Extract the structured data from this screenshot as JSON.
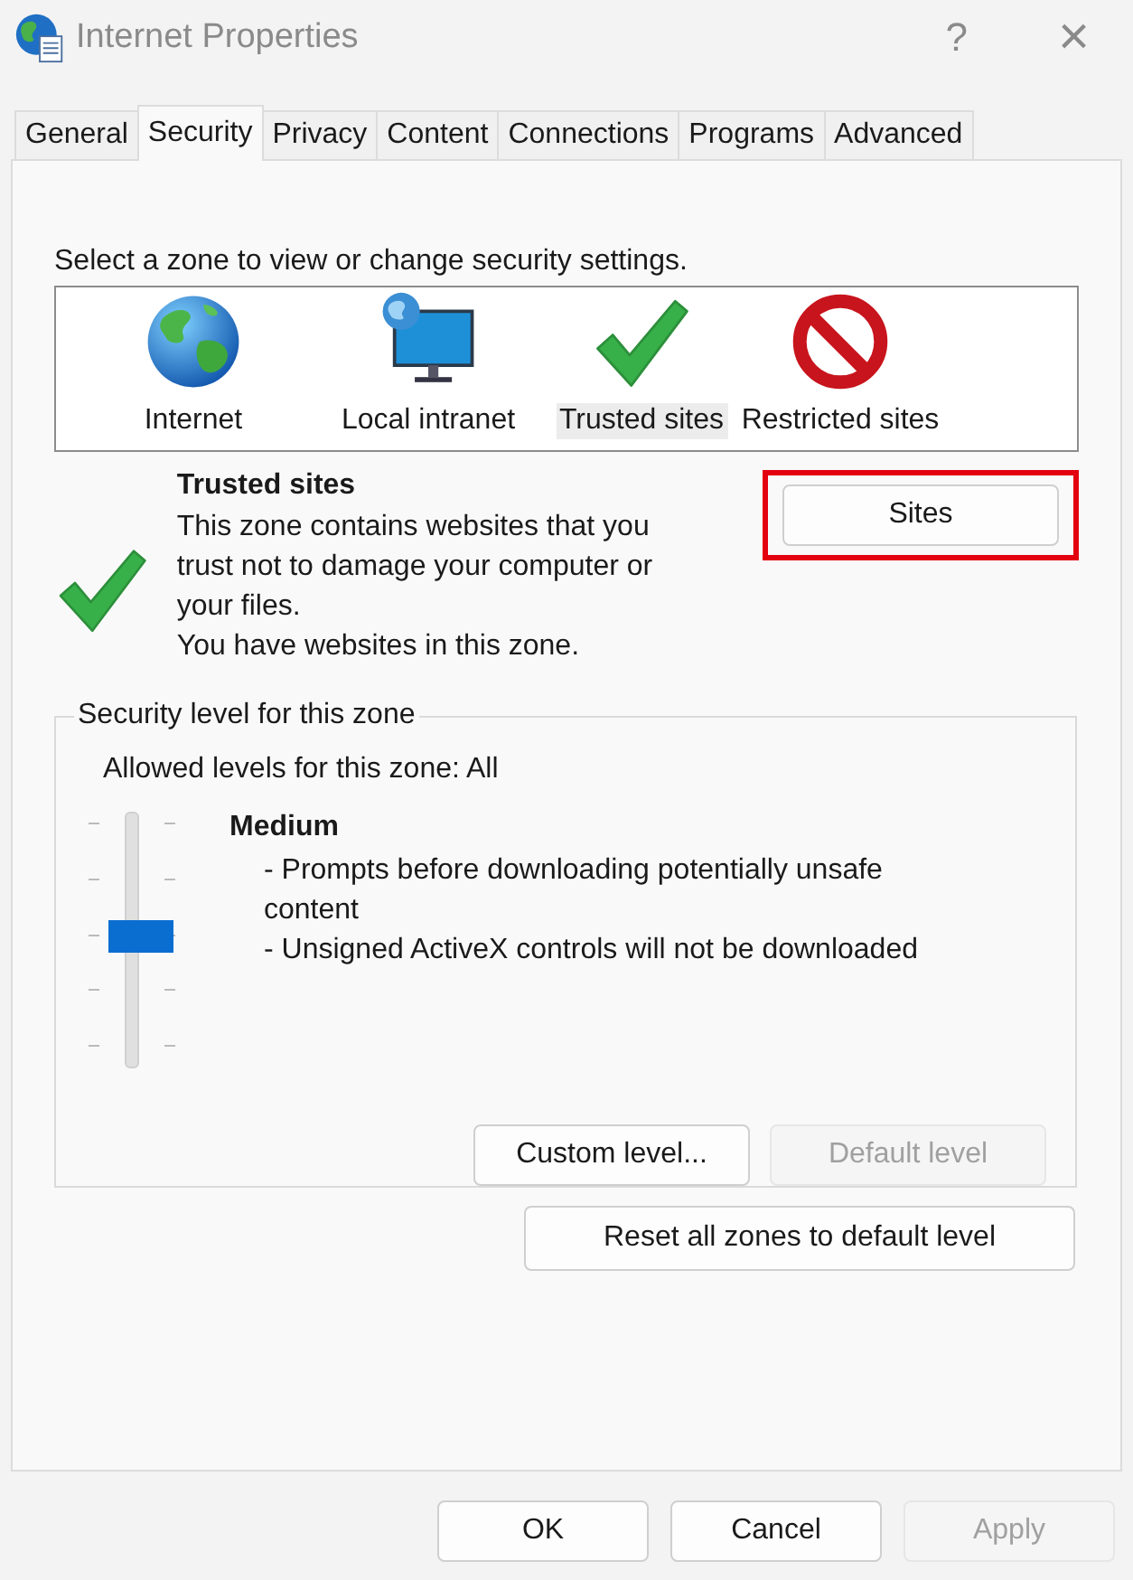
{
  "window": {
    "title": "Internet Properties",
    "help": "?",
    "close": "×"
  },
  "tabs": [
    {
      "label": "General",
      "selected": false
    },
    {
      "label": "Security",
      "selected": true
    },
    {
      "label": "Privacy",
      "selected": false
    },
    {
      "label": "Content",
      "selected": false
    },
    {
      "label": "Connections",
      "selected": false
    },
    {
      "label": "Programs",
      "selected": false
    },
    {
      "label": "Advanced",
      "selected": false
    }
  ],
  "zone_prompt": "Select a zone to view or change security settings.",
  "zones": [
    {
      "label": "Internet",
      "kind": "globe",
      "selected": false
    },
    {
      "label": "Local intranet",
      "kind": "intranet",
      "selected": false
    },
    {
      "label": "Trusted sites",
      "kind": "trusted",
      "selected": true
    },
    {
      "label": "Restricted sites",
      "kind": "restricted",
      "selected": false
    }
  ],
  "zone_info": {
    "kind": "trusted",
    "title": "Trusted sites",
    "description": [
      "This zone contains websites that you trust not to damage your computer or your files.",
      "You have websites in this zone."
    ],
    "button": {
      "label": "Sites",
      "highlighted": true
    }
  },
  "security_level": {
    "legend": "Security level for this zone",
    "allowed": "Allowed levels for this zone: All",
    "level": 0.5,
    "name": "Medium",
    "details": [
      "- Prompts before downloading potentially unsafe content",
      "- Unsigned ActiveX controls will not be downloaded"
    ],
    "buttons": [
      {
        "label": "Custom level...",
        "disabled": false
      },
      {
        "label": "Default level",
        "disabled": true
      }
    ]
  },
  "reset_button": {
    "label": "Reset all zones to default level",
    "disabled": false
  },
  "dialog_buttons": [
    {
      "label": "OK",
      "disabled": false
    },
    {
      "label": "Cancel",
      "disabled": false
    },
    {
      "label": "Apply",
      "disabled": true
    }
  ]
}
